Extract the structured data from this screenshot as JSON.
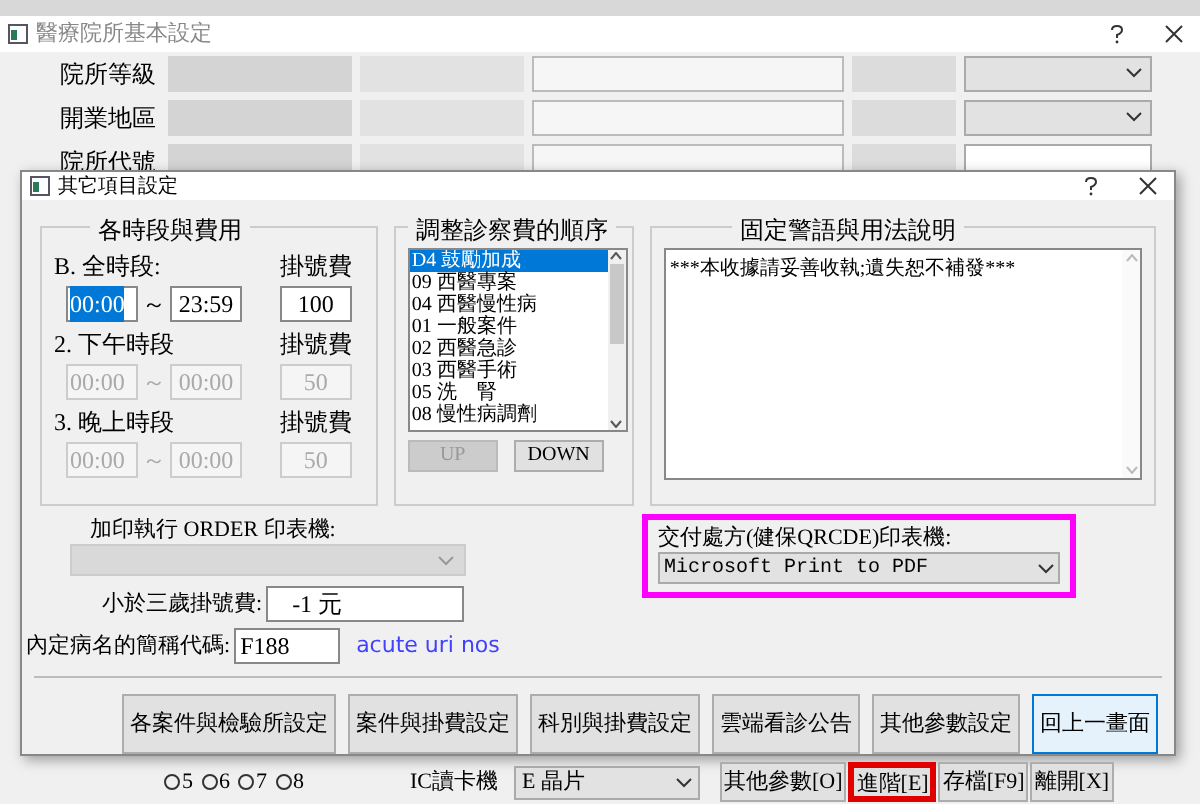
{
  "window": {
    "title": "醫療院所基本設定"
  },
  "form_rows": [
    {
      "label": "院所等級",
      "kind": "select"
    },
    {
      "label": "開業地區",
      "kind": "select"
    },
    {
      "label": "院所代號",
      "kind": "text"
    }
  ],
  "dialog": {
    "title": "其它項目設定",
    "time_group": {
      "title": "各時段與費用",
      "periods": [
        {
          "label": "B. 全時段:",
          "start": "00:00",
          "separator": "～",
          "end": "23:59",
          "fee_label": "掛號費",
          "fee": "100",
          "disabled": false,
          "start_selected": true
        },
        {
          "label": "2. 下午時段",
          "start": "00:00",
          "separator": "～",
          "end": "00:00",
          "fee_label": "掛號費",
          "fee": "50",
          "disabled": true,
          "start_selected": false
        },
        {
          "label": "3. 晚上時段",
          "start": "00:00",
          "separator": "～",
          "end": "00:00",
          "fee_label": "掛號費",
          "fee": "50",
          "disabled": true,
          "start_selected": false
        }
      ]
    },
    "order_group": {
      "title": "調整診察費的順序",
      "items": [
        {
          "text": "D4 鼓勵加成",
          "selected": true
        },
        {
          "text": "09 西醫專案",
          "selected": false
        },
        {
          "text": "04 西醫慢性病",
          "selected": false
        },
        {
          "text": "01 一般案件",
          "selected": false
        },
        {
          "text": "02 西醫急診",
          "selected": false
        },
        {
          "text": "03 西醫手術",
          "selected": false
        },
        {
          "text": "05 洗    腎",
          "selected": false
        },
        {
          "text": "08 慢性病調劑",
          "selected": false
        }
      ],
      "buttons": [
        {
          "label": "UP",
          "disabled": true
        },
        {
          "label": "DOWN",
          "disabled": false
        }
      ]
    },
    "notice_group": {
      "title": "固定警語與用法說明",
      "text": "***本收據請妥善收執;遺失恕不補發***"
    },
    "order_printer": {
      "label": "加印執行 ORDER 印表機:",
      "disabled": true
    },
    "under3_fee": {
      "label": "小於三歲掛號費:",
      "value": "-1 元"
    },
    "default_diagnosis": {
      "label": "內定病名的簡稱代碼:",
      "value": "F188",
      "description": "acute uri nos"
    },
    "qr_printer": {
      "label": "交付處方(健保QRCDE)印表機:",
      "value": "Microsoft Print to PDF",
      "highlighted": true
    },
    "buttons": [
      {
        "label": "各案件與檢驗所設定",
        "focused": false
      },
      {
        "label": "案件與掛費設定",
        "focused": false
      },
      {
        "label": "科別與掛費設定",
        "focused": false
      },
      {
        "label": "雲端看診公告",
        "focused": false
      },
      {
        "label": "其他參數設定",
        "focused": false
      },
      {
        "label": "回上一畫面",
        "focused": true
      }
    ]
  },
  "bottom": {
    "radios": [
      {
        "label": "5",
        "checked": false
      },
      {
        "label": "6",
        "checked": false
      },
      {
        "label": "7",
        "checked": false
      },
      {
        "label": "8",
        "checked": false
      }
    ],
    "ic_reader": {
      "label": "IC讀卡機",
      "value": "E 晶片"
    },
    "buttons": [
      {
        "label": "其他參數[O]",
        "highlighted": false
      },
      {
        "label": "進階[E]",
        "highlighted": true
      },
      {
        "label": "存檔[F9]",
        "highlighted": false
      },
      {
        "label": "離開[X]",
        "highlighted": false
      }
    ]
  }
}
